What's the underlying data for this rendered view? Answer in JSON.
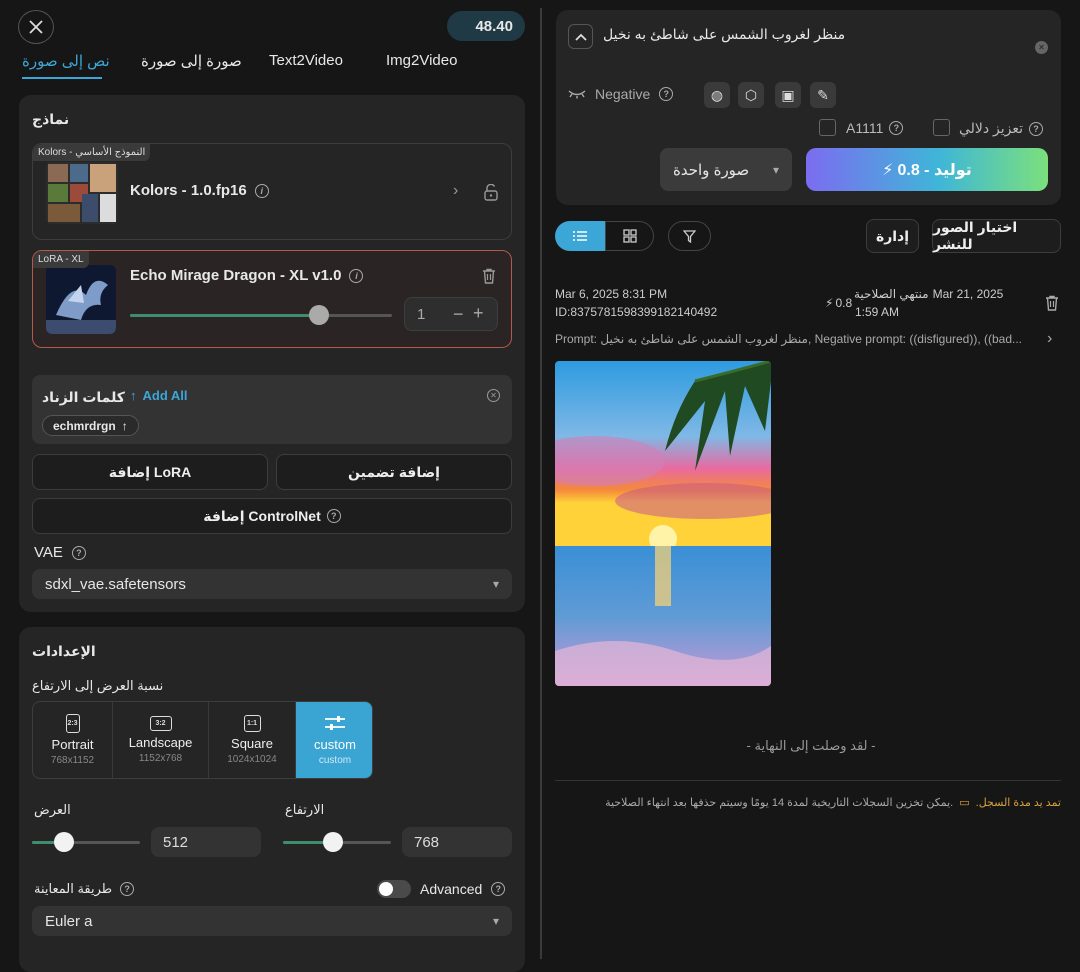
{
  "header": {
    "credits": "48.40",
    "close_icon": "close-icon"
  },
  "tabs": [
    {
      "label": "نص إلى صورة",
      "active": true
    },
    {
      "label": "صورة إلى صورة"
    },
    {
      "label": "Text2Video"
    },
    {
      "label": "Img2Video"
    }
  ],
  "models": {
    "title": "نماذج",
    "base": {
      "badge": "Kolors - النموذج الأساسي",
      "name": "Kolors - 1.0.fp16"
    },
    "lora": {
      "badge": "LoRA - XL",
      "name": "Echo Mirage Dragon - XL v1.0",
      "weight": "1",
      "weight_fraction": 0.72
    }
  },
  "trigger": {
    "title": "كلمات الزناد",
    "add_all": "Add All",
    "word": "echmrdrgn"
  },
  "buttons": {
    "add_embedding": "إضافة تضمين",
    "add_lora": "إضافة LoRA",
    "add_controlnet": "إضافة ControlNet"
  },
  "vae": {
    "label": "VAE",
    "value": "sdxl_vae.safetensors"
  },
  "settings": {
    "title": "الإعدادات",
    "aspect_label": "نسبة العرض إلى الارتفاع",
    "aspects": [
      {
        "icon": "2:3",
        "label": "Portrait",
        "sub": "768x1152"
      },
      {
        "icon": "3:2",
        "label": "Landscape",
        "sub": "1152x768"
      },
      {
        "icon": "1:1",
        "label": "Square",
        "sub": "1024x1024"
      },
      {
        "icon": "",
        "label": "custom",
        "sub": "custom",
        "active": true
      }
    ],
    "width_label": "العرض",
    "width_value": "512",
    "width_fraction": 0.3,
    "height_label": "الارتفاع",
    "height_value": "768",
    "height_fraction": 0.46,
    "sampler_label": "طريقة المعاينة",
    "advanced_label": "Advanced",
    "sampler_value": "Euler a"
  },
  "prompt": {
    "text": "منظر لغروب الشمس على شاطئ به نخيل",
    "negative_label": "Negative",
    "a1111_label": "A1111",
    "semantic_label": "تعزيز دلالي",
    "image_count": "صورة واحدة",
    "generate_label": "0.8 - توليد"
  },
  "toolbar": {
    "manage": "إدارة",
    "select_publish": "اختيار الصور للنشر"
  },
  "record": {
    "date": "Mar 6, 2025 8:31 PM",
    "id": "ID:837578159839918214049​2",
    "cost": "0.8",
    "expiry_date": "Mar 21, 2025",
    "expiry_label": "منتهي الصلاحية",
    "expiry_time": "1:59 AM",
    "prompt_line": "Prompt: منظر لغروب الشمس على شاطئ به نخيل, Negative prompt: ((disfigured)), ((bad..."
  },
  "footer": {
    "end": "- لقد وصلت إلى النهاية -",
    "note": ".يمكن تخزين السجلات التاريخية لمدة 14 يومًا وسيتم حذفها بعد انتهاء الصلاحية",
    "extend": "تمد يد مدة السجل."
  },
  "colors": {
    "accent": "#3ca7d6",
    "lora_border": "#b25a4c",
    "generate_start": "#7c6cf0",
    "generate_end": "#7be07c"
  }
}
